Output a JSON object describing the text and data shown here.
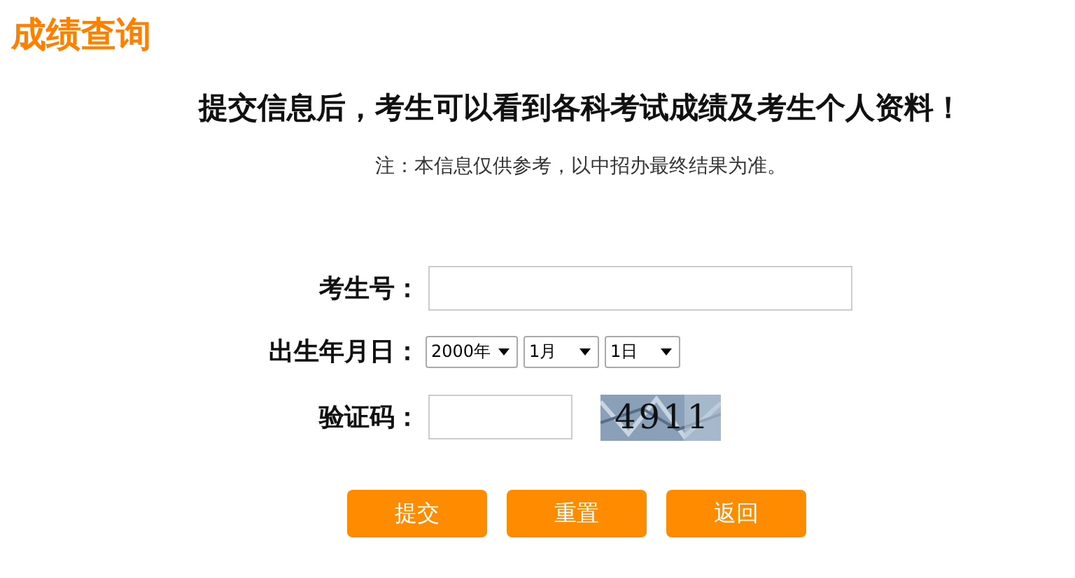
{
  "title": "成绩查询",
  "heading": "提交信息后，考生可以看到各科考试成绩及考生个人资料！",
  "note": "注：本信息仅供参考，以中招办最终结果为准。",
  "form": {
    "fields": [
      {
        "kind": "text",
        "label": "考生号："
      },
      {
        "kind": "date",
        "label": "出生年月日：",
        "selects": [
          "2000年",
          "1月",
          "1日"
        ]
      },
      {
        "kind": "captcha",
        "label": "验证码：",
        "captcha": "4911"
      }
    ]
  },
  "buttons": [
    "提交",
    "重置",
    "返回"
  ]
}
